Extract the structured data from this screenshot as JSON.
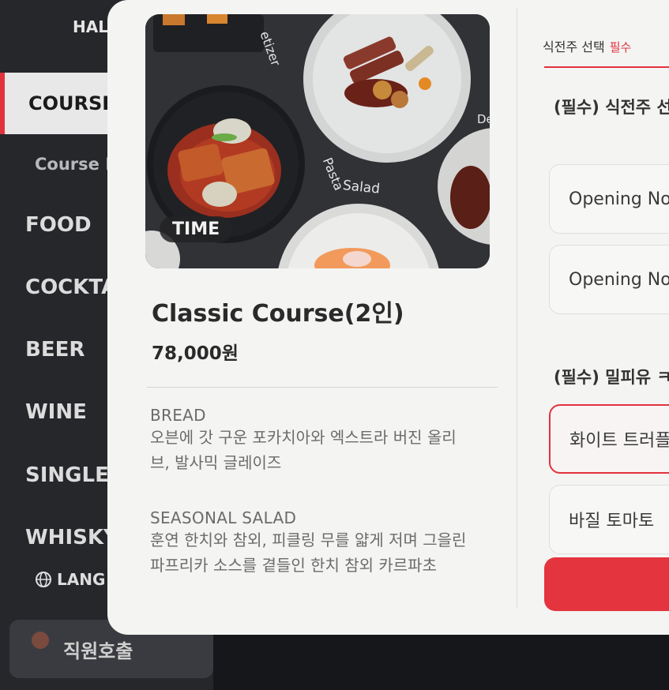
{
  "sidebar": {
    "hall": "HALL",
    "course": "COURSE",
    "course_sub": "Course N",
    "items": [
      {
        "label": "FOOD"
      },
      {
        "label": "COCKTA"
      },
      {
        "label": "BEER"
      },
      {
        "label": "WINE"
      },
      {
        "label": "SINGLE"
      },
      {
        "label": "WHISKY"
      }
    ],
    "language": "LANG",
    "staff_call": "직원호출"
  },
  "modal": {
    "image_badge": "TIME",
    "image_labels": {
      "appetizer": "etizer",
      "pasta": "Pasta",
      "salad": "Salad",
      "dessert": "De"
    },
    "course_title": "Classic Course(2인)",
    "price": "78,000원",
    "menu": [
      {
        "name": "BREAD",
        "desc_lines": [
          "오븐에 갓 구운 포카치아와 엑스트라 버진 올리",
          "브, 발사믹 글레이즈"
        ]
      },
      {
        "name": "SEASONAL SALAD",
        "desc_lines": [
          "훈연 한치와 참외, 피클링 무를 얇게 저며 그을린",
          "파프리카 소스를 곁들인 한치 참외 카르파초"
        ]
      }
    ],
    "options_panel": {
      "tab_label": "식전주 선택",
      "tab_required": "필수",
      "section1_title": "(필수) 식전주 선",
      "section1_options": [
        "Opening No",
        "Opening No"
      ],
      "section2_title": "(필수) 밀피유 ㅋ",
      "section2_options": [
        "화이트 트러플",
        "바질 토마토"
      ]
    }
  },
  "colors": {
    "accent": "#e2323c",
    "modal_bg": "#f4f4f3",
    "sidebar_bg": "#26272b"
  }
}
